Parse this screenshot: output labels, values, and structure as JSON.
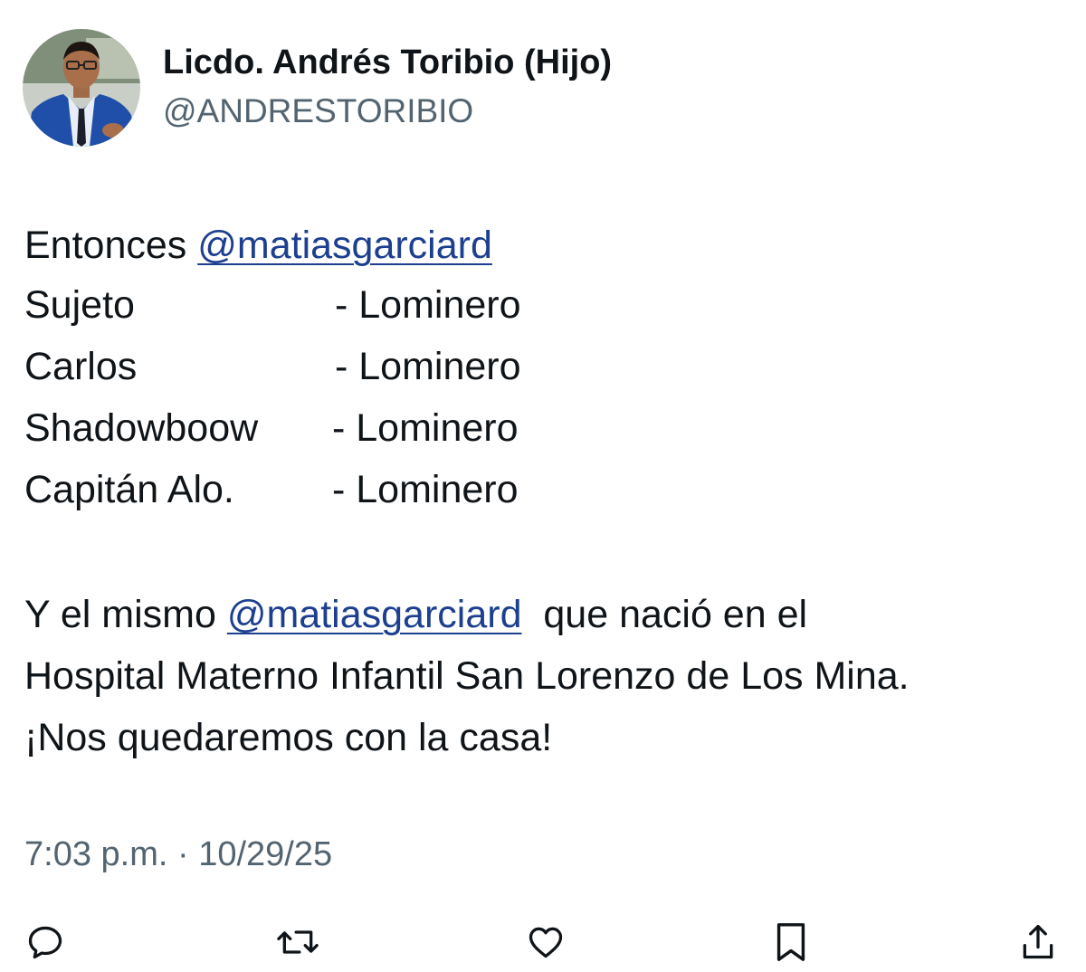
{
  "author": {
    "display_name": "Licdo. Andrés Toribio (Hijo)",
    "handle": "@ANDRESTORIBIO",
    "avatar_icon": "profile-photo"
  },
  "tweet": {
    "intro": "Entonces ",
    "mention": "@matiasgarciard",
    "rows": [
      {
        "name": "Sujeto",
        "value": "- Lominero"
      },
      {
        "name": "Carlos",
        "value": "- Lominero"
      },
      {
        "name": "Shadowboow",
        "value": "- Lominero"
      },
      {
        "name": "Capitán Alo.",
        "value": "- Lominero"
      }
    ],
    "para2_prefix": "Y el mismo ",
    "para2_suffix": "  que nació en el",
    "para2_line2": "Hospital Materno Infantil San Lorenzo de Los Mina.",
    "para2_line3": "¡Nos quedaremos con la casa!"
  },
  "timestamp": "7:03 p.m. · 10/29/25",
  "actions": [
    {
      "name": "reply",
      "icon": "reply-icon"
    },
    {
      "name": "repost",
      "icon": "repost-icon"
    },
    {
      "name": "like",
      "icon": "like-icon"
    },
    {
      "name": "bookmark",
      "icon": "bookmark-icon"
    },
    {
      "name": "share",
      "icon": "share-icon"
    }
  ],
  "colors": {
    "text": "#0f1419",
    "secondary": "#536471",
    "mention": "#1d3f8f"
  }
}
